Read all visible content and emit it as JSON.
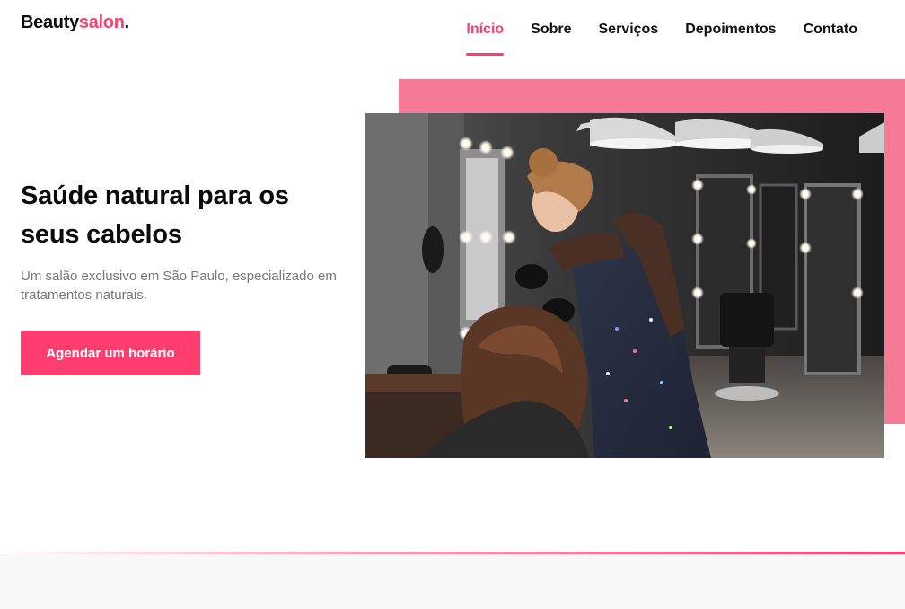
{
  "header": {
    "logo": {
      "main": "Beauty",
      "accent": "salon",
      "dot": "."
    },
    "nav": [
      {
        "label": "Início",
        "active": true
      },
      {
        "label": "Sobre",
        "active": false
      },
      {
        "label": "Serviços",
        "active": false
      },
      {
        "label": "Depoimentos",
        "active": false
      },
      {
        "label": "Contato",
        "active": false
      }
    ]
  },
  "hero": {
    "title": "Saúde natural para os seus cabelos",
    "subtitle": "Um salão exclusivo em São Paulo, especializado em tratamentos naturais.",
    "cta_label": "Agendar um horário"
  },
  "colors": {
    "accent": "#ff3d6e",
    "pink_block": "#f57a96",
    "text": "#0d0d0d",
    "muted": "#777777"
  },
  "image": {
    "subject": "hairdresser-styling-client-photo"
  }
}
